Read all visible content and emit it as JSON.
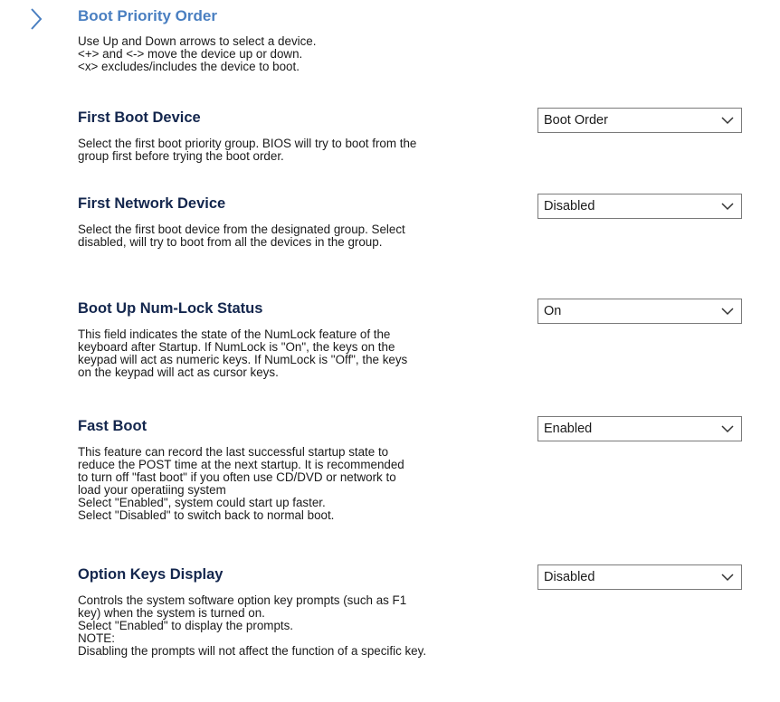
{
  "boot_priority": {
    "title": "Boot Priority Order",
    "description": "Use Up and Down arrows to select a device.\n<+> and <-> move the device up or down.\n<x> excludes/includes the device to boot."
  },
  "settings": [
    {
      "title": "First Boot Device",
      "value": "Boot Order",
      "description": "Select the first boot priority group. BIOS will try to boot from the\ngroup first before trying the boot order."
    },
    {
      "title": "First Network Device",
      "value": "Disabled",
      "description": "Select the first boot device from the designated group. Select\ndisabled, will try to boot from all the devices in the group."
    },
    {
      "title": "Boot Up Num-Lock Status",
      "value": "On",
      "description": "This field indicates the state of the NumLock feature of the\nkeyboard after Startup. If NumLock is \"On\", the keys on the\nkeypad will act as numeric keys. If NumLock is \"Off\", the keys\non the keypad will act as cursor keys."
    },
    {
      "title": "Fast Boot",
      "value": "Enabled",
      "description": "This feature can record the last successful startup state to\nreduce the POST time at the next startup. It is recommended\nto turn off \"fast boot\" if you often use CD/DVD or network to\nload your operatiing system\nSelect \"Enabled\", system could start up faster.\nSelect \"Disabled\" to switch back to normal boot."
    },
    {
      "title": "Option Keys Display",
      "value": "Disabled",
      "description": "Controls the system software option key prompts (such as F1\nkey) when the system is turned on.\nSelect \"Enabled\" to display the prompts.\nNOTE:\nDisabling the prompts will not affect the function of a specific key."
    }
  ],
  "icons": {
    "expander": "chevron-right-icon",
    "dropdown": "chevron-down-icon"
  },
  "colors": {
    "expander_title": "#4a7fc1",
    "setting_title": "#13264d",
    "chevron": "#4a7fc1"
  }
}
